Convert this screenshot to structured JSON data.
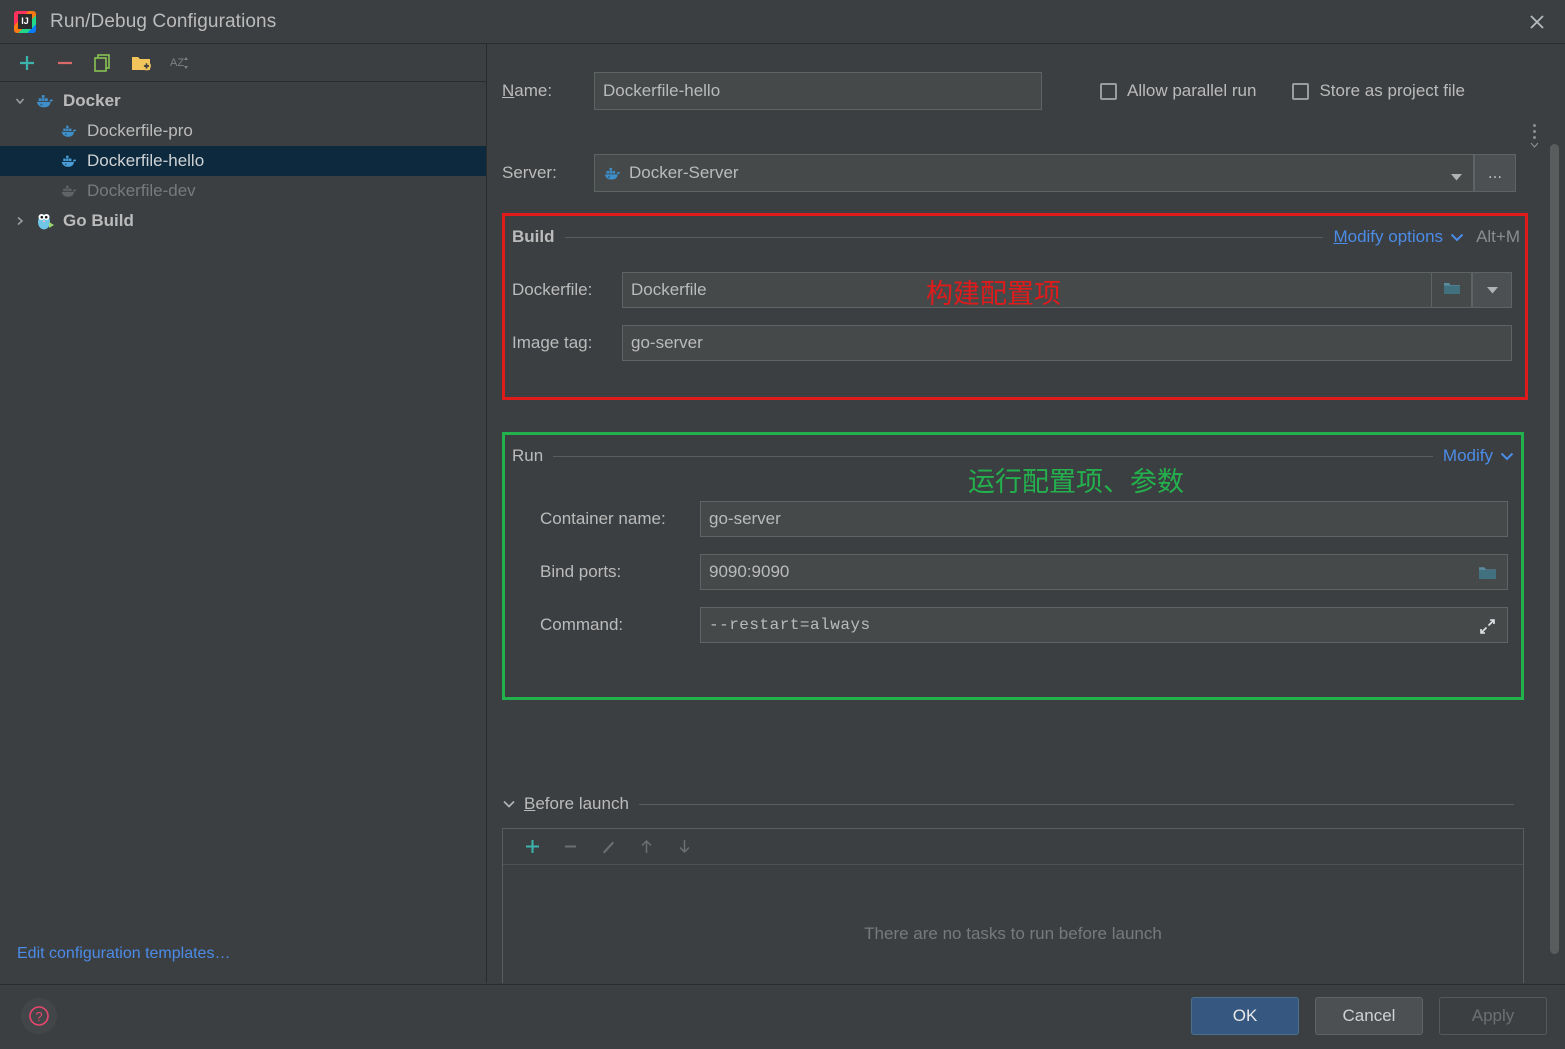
{
  "window": {
    "title": "Run/Debug Configurations",
    "app_icon": "intellij-idea-icon",
    "close_icon": "close-icon"
  },
  "left_panel": {
    "toolbar": [
      {
        "name": "add-configuration-button",
        "icon": "plus-icon",
        "label": "+"
      },
      {
        "name": "remove-configuration-button",
        "icon": "minus-icon",
        "label": "−"
      },
      {
        "name": "copy-configuration-button",
        "icon": "copy-icon",
        "label": "Copy"
      },
      {
        "name": "new-folder-button",
        "icon": "folder-add-icon",
        "label": "New Folder"
      },
      {
        "name": "sort-configurations-button",
        "icon": "sort-alphabetically-icon",
        "label": "AZ"
      }
    ],
    "tree": [
      {
        "label": "Docker",
        "icon": "docker-icon",
        "level": 0,
        "expanded": true,
        "state": "group"
      },
      {
        "label": "Dockerfile-pro",
        "icon": "docker-icon",
        "level": 1,
        "state": "normal"
      },
      {
        "label": "Dockerfile-hello",
        "icon": "docker-icon",
        "level": 1,
        "state": "selected"
      },
      {
        "label": "Dockerfile-dev",
        "icon": "docker-icon",
        "level": 1,
        "state": "disabled"
      },
      {
        "label": "Go Build",
        "icon": "go-gopher-icon",
        "level": 0,
        "expanded": false,
        "state": "group"
      }
    ],
    "edit_templates_link": "Edit configuration templates…"
  },
  "form": {
    "name_label": "Name:",
    "name_mnemonic": "N",
    "name_value": "Dockerfile-hello",
    "allow_parallel_run_label": "Allow parallel run",
    "allow_parallel_run_checked": false,
    "store_as_project_file_label": "Store as project file",
    "store_as_project_file_checked": false,
    "more_options_icon": "more-options-icon",
    "server_label": "Server:",
    "server_value": "Docker-Server",
    "server_icon": "docker-icon",
    "server_dropdown_icon": "chevron-down-icon",
    "server_browse_label": "..."
  },
  "build_section": {
    "title": "Build",
    "modify_options_link": "Modify options",
    "modify_options_mnemonic": "M",
    "modify_options_chevron": "chevron-down-icon",
    "shortcut_hint": "Alt+M",
    "dockerfile_label": "Dockerfile:",
    "dockerfile_value": "Dockerfile",
    "dockerfile_browse_icon": "folder-icon",
    "dockerfile_history_icon": "chevron-down-icon",
    "image_tag_label": "Image tag:",
    "image_tag_value": "go-server",
    "annotation": "构建配置项",
    "annotation_color": "#e01b1b",
    "border_color": "#e01b1b"
  },
  "run_section": {
    "title": "Run",
    "modify_link": "Modify",
    "modify_chevron": "chevron-down-icon",
    "container_name_label": "Container name:",
    "container_name_value": "go-server",
    "bind_ports_label": "Bind ports:",
    "bind_ports_value": "9090:9090",
    "bind_ports_browse_icon": "folder-icon",
    "command_label": "Command:",
    "command_value": "--restart=always",
    "command_expand_icon": "expand-icon",
    "annotation": "运行配置项、参数",
    "annotation_color": "#23b14d",
    "border_color": "#23b14d"
  },
  "before_launch": {
    "title": "Before launch",
    "title_mnemonic": "B",
    "collapse_icon": "chevron-down-icon",
    "toolbar": [
      {
        "name": "add-task-button",
        "icon": "plus-icon",
        "enabled": true
      },
      {
        "name": "remove-task-button",
        "icon": "minus-icon",
        "enabled": false
      },
      {
        "name": "edit-task-button",
        "icon": "pencil-icon",
        "enabled": false
      },
      {
        "name": "move-task-up-button",
        "icon": "arrow-up-icon",
        "enabled": false
      },
      {
        "name": "move-task-down-button",
        "icon": "arrow-down-icon",
        "enabled": false
      }
    ],
    "empty_text": "There are no tasks to run before launch"
  },
  "footer": {
    "help_icon": "help-icon",
    "ok_label": "OK",
    "cancel_label": "Cancel",
    "apply_label": "Apply",
    "apply_enabled": false,
    "ok_color": "#365880"
  }
}
